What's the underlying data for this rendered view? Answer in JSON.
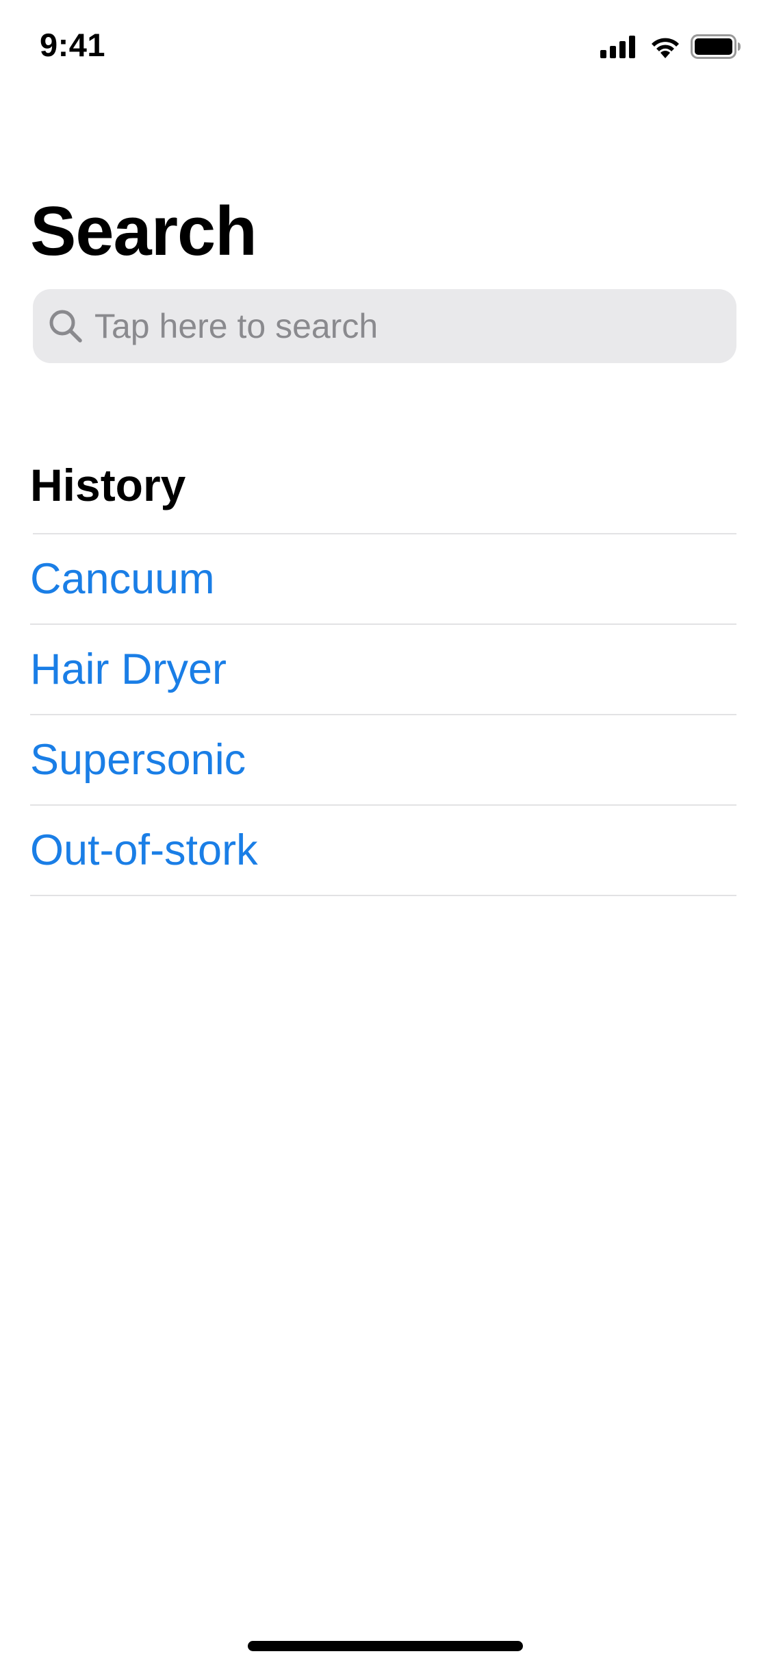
{
  "status_bar": {
    "time": "9:41",
    "icons": [
      "signal-icon",
      "wifi-icon",
      "battery-icon"
    ]
  },
  "header": {
    "title": "Search"
  },
  "search": {
    "placeholder": "Tap here to search",
    "value": "",
    "icon": "search-icon"
  },
  "history": {
    "heading": "History",
    "items": [
      {
        "label": "Cancuum"
      },
      {
        "label": "Hair Dryer"
      },
      {
        "label": "Supersonic"
      },
      {
        "label": "Out-of-stork"
      }
    ]
  },
  "colors": {
    "link": "#1a7ee6",
    "search_bg": "#e9e9eb",
    "placeholder": "#8a8a8e",
    "separator": "#e2e2e4"
  }
}
